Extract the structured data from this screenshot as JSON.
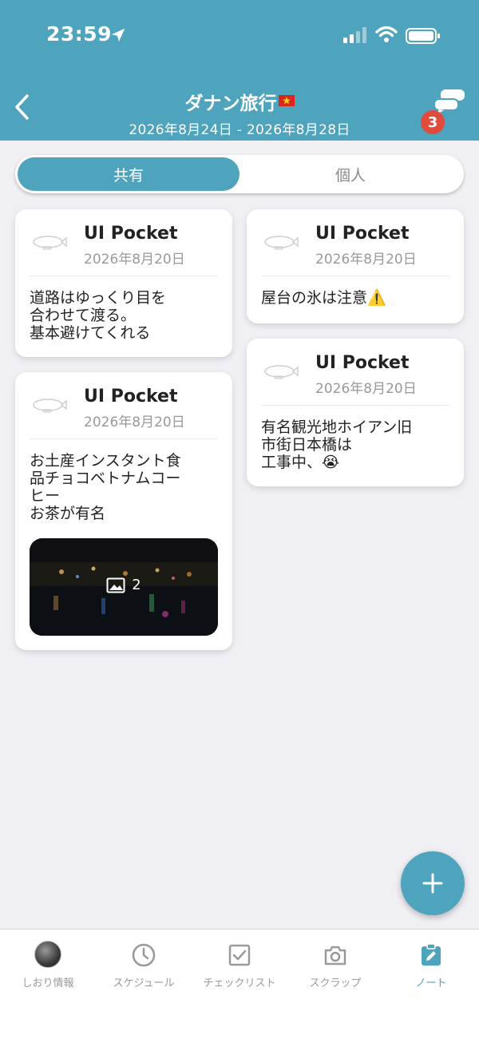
{
  "status_bar": {
    "time": "23:59"
  },
  "header": {
    "title": "ダナン旅行",
    "dates": "2026年8月24日 - 2026年8月28日",
    "chat_badge": "3"
  },
  "segment": {
    "shared": "共有",
    "personal": "個人",
    "selected": "shared"
  },
  "notes": [
    {
      "author": "UI Pocket",
      "date": "2026年8月20日",
      "text": "道路はゆっくり目を\n合わせて渡る。\n基本避けてくれる"
    },
    {
      "author": "UI Pocket",
      "date": "2026年8月20日",
      "text": "お土産インスタント食\n品チョコベトナムコー\nヒー\nお茶が有名",
      "photo_count": "2"
    },
    {
      "author": "UI Pocket",
      "date": "2026年8月20日",
      "text": "屋台の氷は注意⚠️"
    },
    {
      "author": "UI Pocket",
      "date": "2026年8月20日",
      "text": "有名観光地ホイアン旧\n市街日本橋は\n工事中、😭"
    }
  ],
  "tabs": [
    {
      "label": "しおり情報",
      "icon": "avatar-icon"
    },
    {
      "label": "スケジュール",
      "icon": "clock-icon"
    },
    {
      "label": "チェックリスト",
      "icon": "checkbox-icon"
    },
    {
      "label": "スクラップ",
      "icon": "camera-icon"
    },
    {
      "label": "ノート",
      "icon": "note-icon",
      "active": true
    }
  ],
  "colors": {
    "primary": "#4ea3bd",
    "badge": "#e24b3b",
    "background": "#efeff4"
  }
}
